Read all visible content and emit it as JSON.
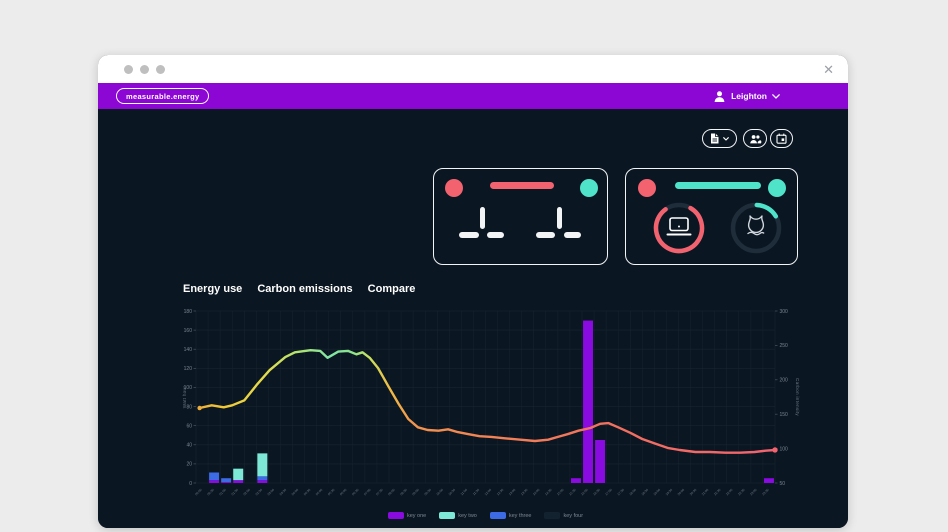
{
  "window": {
    "close_label": "✕"
  },
  "header": {
    "brand": "measurable.energy",
    "user_name": "Leighton"
  },
  "toolbar": {
    "buttons": [
      {
        "id": "export",
        "icon": "document-chevron-icon"
      },
      {
        "id": "users",
        "icon": "people-icon"
      },
      {
        "id": "calendar",
        "icon": "calendar-icon"
      }
    ]
  },
  "summary_cards": {
    "card_one": {
      "state": "loading-skeleton",
      "accent_left_color": "#F2636F",
      "title_bar_color": "#F2636F",
      "accent_right_color": "#4FE3C9"
    },
    "card_two": {
      "accent_left_color": "#F2636F",
      "title_bar_color": "#4FE3C9",
      "accent_right_color": "#4FE3C9",
      "gauges": [
        {
          "icon": "laptop",
          "color": "#F2636F",
          "fraction": 0.82
        },
        {
          "icon": "flame",
          "color": "#4FE3C9",
          "fraction": 0.17
        }
      ]
    }
  },
  "tabs": [
    {
      "label": "Energy use"
    },
    {
      "label": "Carbon emissions"
    },
    {
      "label": "Compare"
    }
  ],
  "legend": {
    "items": [
      {
        "label": "key one",
        "color": "#8A0BE0"
      },
      {
        "label": "key two",
        "color": "#7CE8D5"
      },
      {
        "label": "key three",
        "color": "#3D6BE5"
      },
      {
        "label": "key four",
        "color": "#13222F"
      }
    ]
  },
  "chart_data": {
    "type": "mixed-bar-line",
    "grid": true,
    "x_labels": [
      "00:00",
      "00:30",
      "01:00",
      "01:30",
      "02:00",
      "02:30",
      "03:00",
      "03:30",
      "04:00",
      "04:30",
      "05:00",
      "05:30",
      "06:00",
      "06:30",
      "07:00",
      "07:30",
      "08:00",
      "08:30",
      "09:00",
      "09:30",
      "10:00",
      "10:30",
      "11:00",
      "11:30",
      "12:00",
      "12:30",
      "13:00",
      "13:30",
      "14:00",
      "14:30",
      "15:00",
      "15:30",
      "16:00",
      "16:30",
      "17:00",
      "17:30",
      "18:00",
      "18:30",
      "19:00",
      "19:30",
      "20:00",
      "20:30",
      "21:00",
      "21:30",
      "22:00",
      "22:30",
      "23:00",
      "23:30"
    ],
    "left_axis": {
      "label": "Watt hour",
      "min": 0,
      "max": 180,
      "ticks": [
        0,
        20,
        40,
        60,
        80,
        100,
        120,
        140,
        160,
        180
      ]
    },
    "right_axis": {
      "label": "Carbon intensity",
      "min": 50,
      "max": 300,
      "ticks": [
        50,
        100,
        150,
        200,
        250,
        300
      ]
    },
    "stack_order": [
      "key_one",
      "key_three",
      "key_two"
    ],
    "bar_colors": {
      "key_one": "#8A0BE0",
      "key_two": "#7CE8D5",
      "key_three": "#3D6BE5"
    },
    "bars": [
      {
        "slot": 1,
        "segments": {
          "key_one": 3,
          "key_three": 8
        }
      },
      {
        "slot": 2,
        "segments": {
          "key_one": 1,
          "key_three": 4
        }
      },
      {
        "slot": 3,
        "segments": {
          "key_one": 3,
          "key_two": 12
        }
      },
      {
        "slot": 5,
        "segments": {
          "key_one": 3,
          "key_three": 4,
          "key_two": 24
        }
      },
      {
        "slot": 31,
        "segments": {
          "key_one": 5
        }
      },
      {
        "slot": 32,
        "segments": {
          "key_one": 170
        }
      },
      {
        "slot": 33,
        "segments": {
          "key_one": 45
        }
      },
      {
        "slot": 47,
        "segments": {
          "key_one": 5
        }
      }
    ],
    "line": {
      "name": "Carbon intensity",
      "axis": "right",
      "points": [
        [
          0.3,
          159
        ],
        [
          1.3,
          163
        ],
        [
          2.3,
          160
        ],
        [
          3.0,
          163
        ],
        [
          4.0,
          170
        ],
        [
          5.1,
          194
        ],
        [
          6.1,
          214
        ],
        [
          7.4,
          233
        ],
        [
          8.2,
          240
        ],
        [
          9.5,
          243
        ],
        [
          10.3,
          242
        ],
        [
          10.9,
          232
        ],
        [
          11.8,
          241
        ],
        [
          12.6,
          242
        ],
        [
          13.3,
          237
        ],
        [
          13.8,
          240
        ],
        [
          14.4,
          232
        ],
        [
          15.1,
          217
        ],
        [
          15.9,
          192
        ],
        [
          16.8,
          165
        ],
        [
          17.6,
          143
        ],
        [
          18.4,
          131
        ],
        [
          19.2,
          127
        ],
        [
          20.1,
          126
        ],
        [
          20.9,
          128
        ],
        [
          21.7,
          124
        ],
        [
          22.6,
          121
        ],
        [
          23.5,
          118
        ],
        [
          24.5,
          117
        ],
        [
          25.6,
          115
        ],
        [
          26.9,
          113
        ],
        [
          28.1,
          111
        ],
        [
          29.2,
          113
        ],
        [
          30.0,
          117
        ],
        [
          30.8,
          121
        ],
        [
          31.7,
          126
        ],
        [
          32.7,
          130
        ],
        [
          33.5,
          136
        ],
        [
          34.2,
          137
        ],
        [
          35.0,
          131
        ],
        [
          36.0,
          123
        ],
        [
          37.0,
          114
        ],
        [
          38.1,
          107
        ],
        [
          39.1,
          101
        ],
        [
          40.1,
          98
        ],
        [
          41.4,
          95
        ],
        [
          42.6,
          95
        ],
        [
          43.9,
          94
        ],
        [
          45.1,
          94
        ],
        [
          46.3,
          95
        ],
        [
          47.2,
          97
        ],
        [
          48.0,
          98
        ]
      ],
      "gradient": [
        {
          "offset": 0,
          "color": "#EDAE3E"
        },
        {
          "offset": 0.05,
          "color": "#F0C936"
        },
        {
          "offset": 0.12,
          "color": "#E3DC4D"
        },
        {
          "offset": 0.18,
          "color": "#AEE472"
        },
        {
          "offset": 0.23,
          "color": "#7FE5A4"
        },
        {
          "offset": 0.27,
          "color": "#8BE48C"
        },
        {
          "offset": 0.3,
          "color": "#C9E05E"
        },
        {
          "offset": 0.335,
          "color": "#F0BC45"
        },
        {
          "offset": 0.375,
          "color": "#F2944E"
        },
        {
          "offset": 0.5,
          "color": "#F28354"
        },
        {
          "offset": 0.72,
          "color": "#F2705F"
        },
        {
          "offset": 1,
          "color": "#F2636F"
        }
      ],
      "start_dot_color": "#EDAE3E",
      "end_dot_color": "#F2636F"
    }
  }
}
